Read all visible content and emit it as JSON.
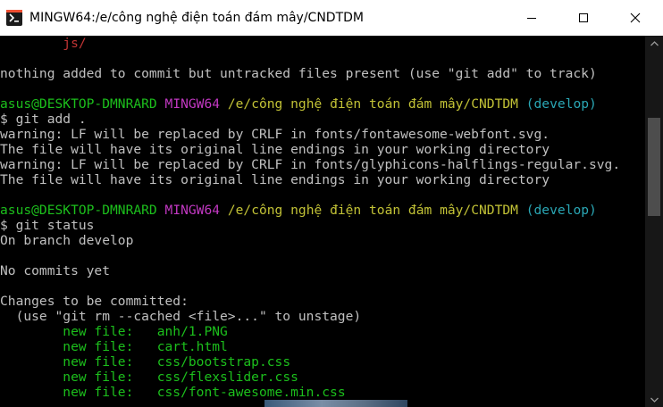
{
  "window": {
    "title": "MINGW64:/e/công nghệ điện toán đám mây/CNDTDM"
  },
  "colors": {
    "green": "#1cbf1c",
    "magenta": "#c238c2",
    "yellow": "#c2c236",
    "cyan": "#2aa7b5",
    "red": "#c23535",
    "text": "#c0c0c0"
  },
  "terminal": {
    "line_js": "        js/",
    "line_nothing": "nothing added to commit but untracked files present (use \"git add\" to track)",
    "prompt1": {
      "user": "asus@DESKTOP-DMNRARD",
      "shell": "MINGW64",
      "path": "/e/công nghệ điện toán đám mây/CNDTDM",
      "branch": "(develop)"
    },
    "cmd1": "$ git add .",
    "warn1": "warning: LF will be replaced by CRLF in fonts/fontawesome-webfont.svg.",
    "warn1b": "The file will have its original line endings in your working directory",
    "warn2": "warning: LF will be replaced by CRLF in fonts/glyphicons-halflings-regular.svg.",
    "warn2b": "The file will have its original line endings in your working directory",
    "prompt2": {
      "user": "asus@DESKTOP-DMNRARD",
      "shell": "MINGW64",
      "path": "/e/công nghệ điện toán đám mây/CNDTDM",
      "branch": "(develop)"
    },
    "cmd2": "$ git status",
    "on_branch": "On branch develop",
    "no_commits": "No commits yet",
    "changes_header": "Changes to be committed:",
    "unstage_hint": "  (use \"git rm --cached <file>...\" to unstage)",
    "new_files": [
      {
        "label": "        new file:   ",
        "path": "anh/1.PNG"
      },
      {
        "label": "        new file:   ",
        "path": "cart.html"
      },
      {
        "label": "        new file:   ",
        "path": "css/bootstrap.css"
      },
      {
        "label": "        new file:   ",
        "path": "css/flexslider.css"
      },
      {
        "label": "        new file:   ",
        "path": "css/font-awesome.min.css"
      }
    ]
  }
}
